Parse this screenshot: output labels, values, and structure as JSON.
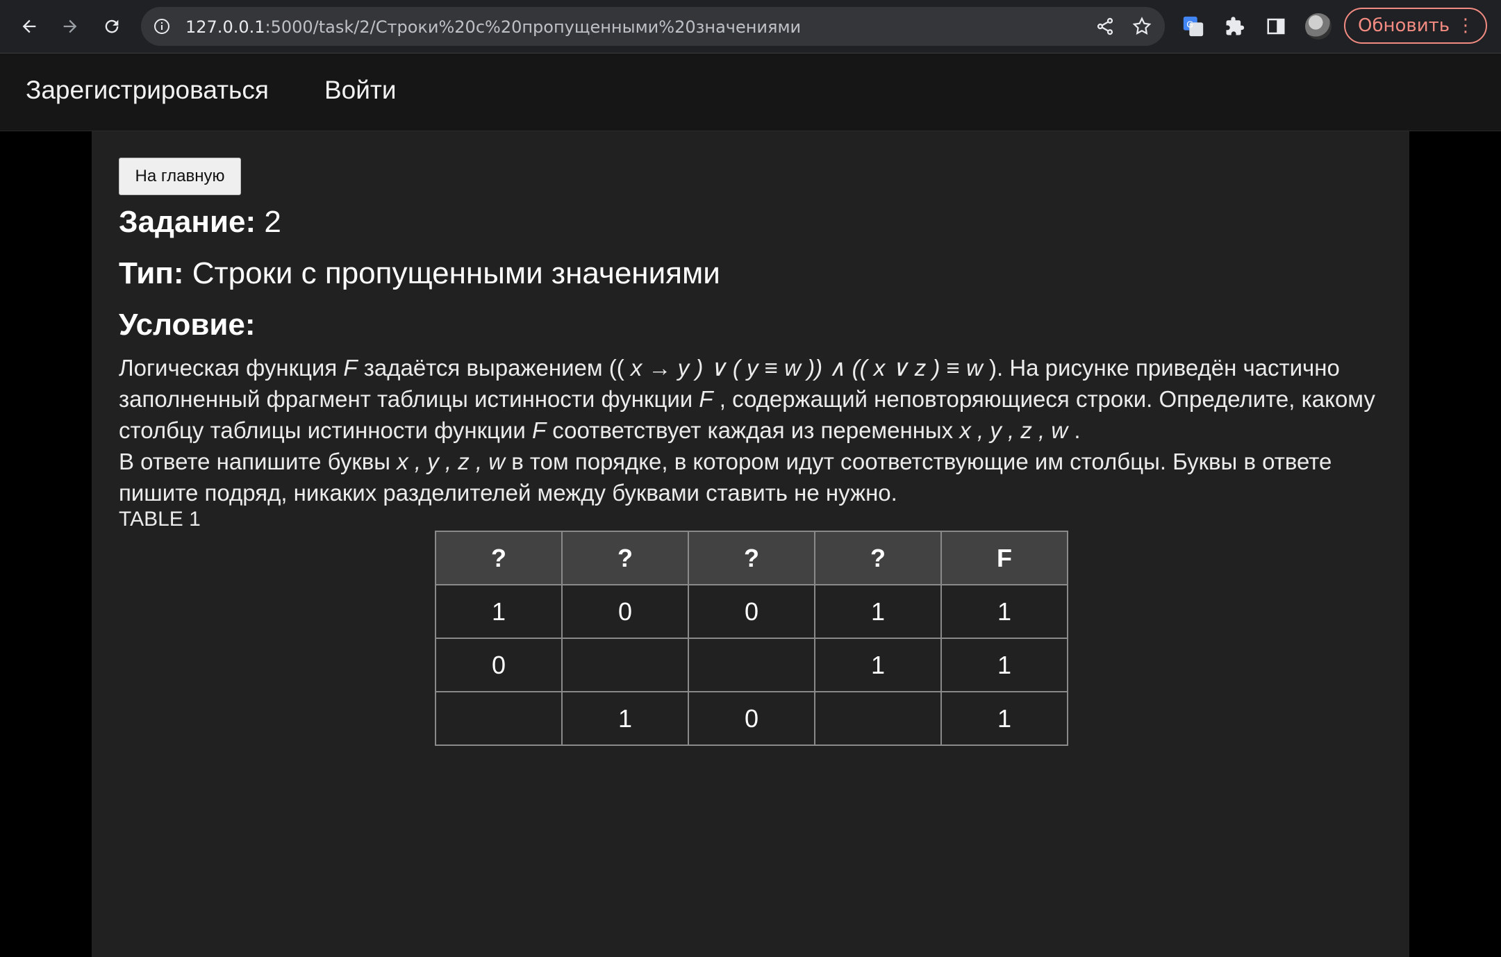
{
  "browser": {
    "url_host": "127.0.0.1",
    "url_rest": ":5000/task/2/Строки%20с%20пропущенными%20значениями",
    "update_button": "Обновить"
  },
  "site_nav": {
    "register": "Зарегистрироваться",
    "login": "Войти"
  },
  "task": {
    "home_button": "На главную",
    "task_label": "Задание:",
    "task_number": "2",
    "type_label": "Тип:",
    "type_value": "Строки с пропущенными значениями",
    "condition_label": "Условие:",
    "condition_line1_a": "Логическая функция ",
    "condition_F": "F",
    "condition_line1_b": " задаётся выражением ((",
    "expr": " x → y ) ∨ ( y ≡ w )) ∧ (( x ∨ z ) ≡ w ",
    "condition_line1_c": "). На рисунке приведён частично заполненный фрагмент таблицы истинности функции ",
    "condition_line1_d": " , содержащий неповторяющиеся строки. Определите, какому столбцу таблицы истинности функции ",
    "condition_line1_e": " соответствует каждая из переменных ",
    "vars": "x , y , z , w",
    "condition_line1_f": " .",
    "answer_a": "В ответе напишите буквы ",
    "answer_b": " в том порядке, в котором идут соответствующие им столбцы. Буквы в ответе пишите подряд, никаких разделителей между буквами ставить не нужно.",
    "table_label": "TABLE 1"
  },
  "truth_table": {
    "headers": [
      "?",
      "?",
      "?",
      "?",
      "F"
    ],
    "rows": [
      [
        "1",
        "0",
        "0",
        "1",
        "1"
      ],
      [
        "0",
        "",
        "",
        "1",
        "1"
      ],
      [
        "",
        "1",
        "0",
        "",
        "1"
      ]
    ]
  }
}
